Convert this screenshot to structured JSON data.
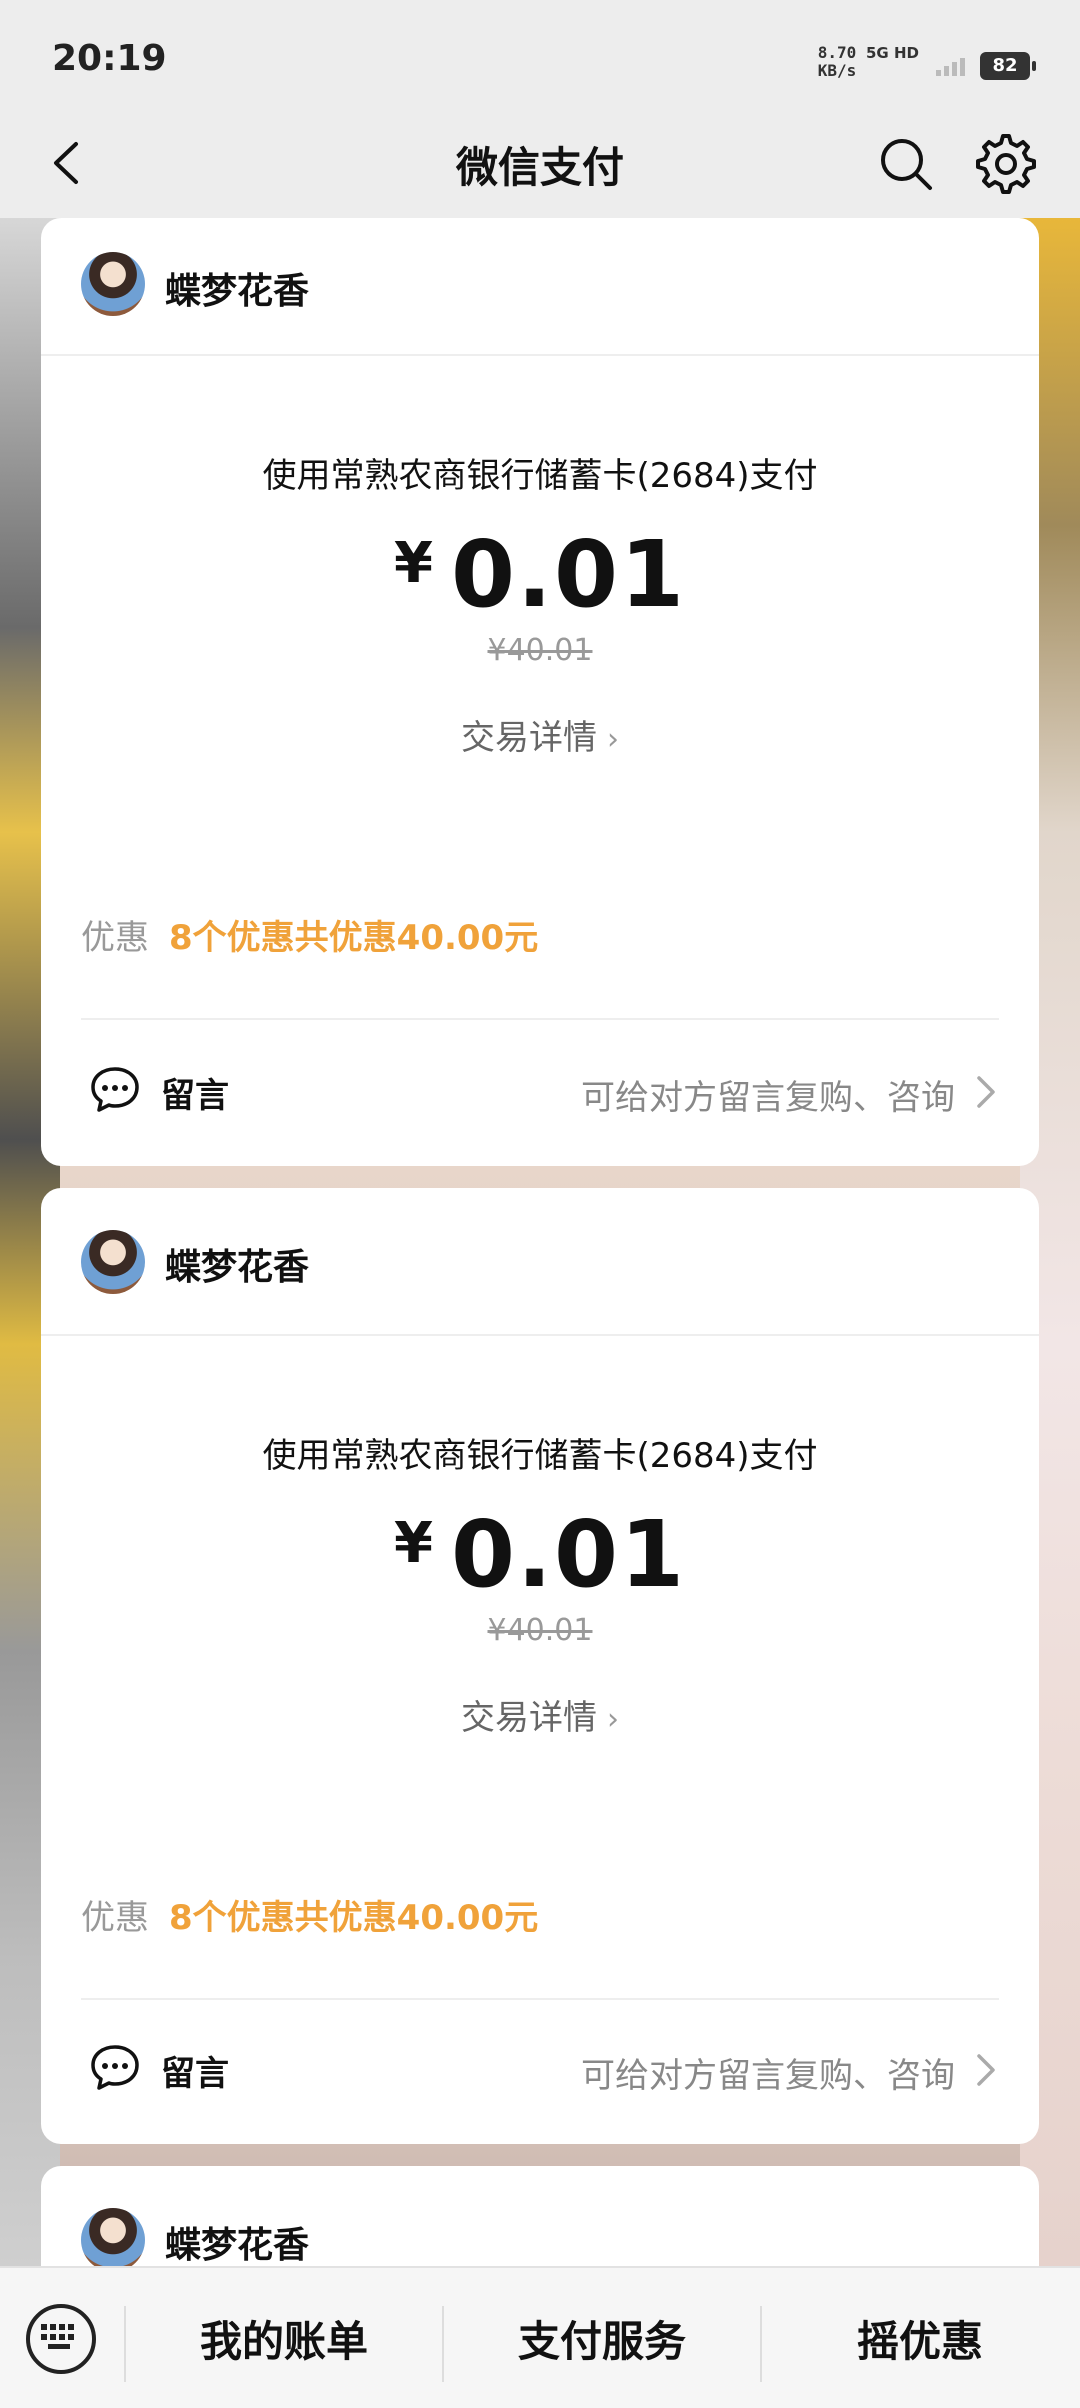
{
  "status_bar": {
    "time": "20:19",
    "net_speed_value": "8.70",
    "net_speed_unit": "KB/s",
    "network_label": "5G HD",
    "battery": "82"
  },
  "nav": {
    "title": "微信支付",
    "back_icon": "chevron-left-icon",
    "search_icon": "search-icon",
    "settings_icon": "gear-icon"
  },
  "cards": [
    {
      "merchant": "蝶梦花香",
      "pay_method": "使用常熟农商银行储蓄卡(2684)支付",
      "currency": "¥",
      "amount": "0.01",
      "original_amount": "¥40.01",
      "detail_link": "交易详情",
      "promo_label": "优惠",
      "promo_text": "8个优惠共优惠40.00元",
      "message_label": "留言",
      "message_hint": "可给对方留言复购、咨询"
    },
    {
      "merchant": "蝶梦花香",
      "pay_method": "使用常熟农商银行储蓄卡(2684)支付",
      "currency": "¥",
      "amount": "0.01",
      "original_amount": "¥40.01",
      "detail_link": "交易详情",
      "promo_label": "优惠",
      "promo_text": "8个优惠共优惠40.00元",
      "message_label": "留言",
      "message_hint": "可给对方留言复购、咨询"
    },
    {
      "merchant": "蝶梦花香"
    }
  ],
  "bottom_bar": {
    "keyboard_icon": "keyboard-icon",
    "items": [
      "我的账单",
      "支付服务",
      "摇优惠"
    ]
  },
  "colors": {
    "promo": "#f0a23a",
    "background": "#ededed"
  }
}
